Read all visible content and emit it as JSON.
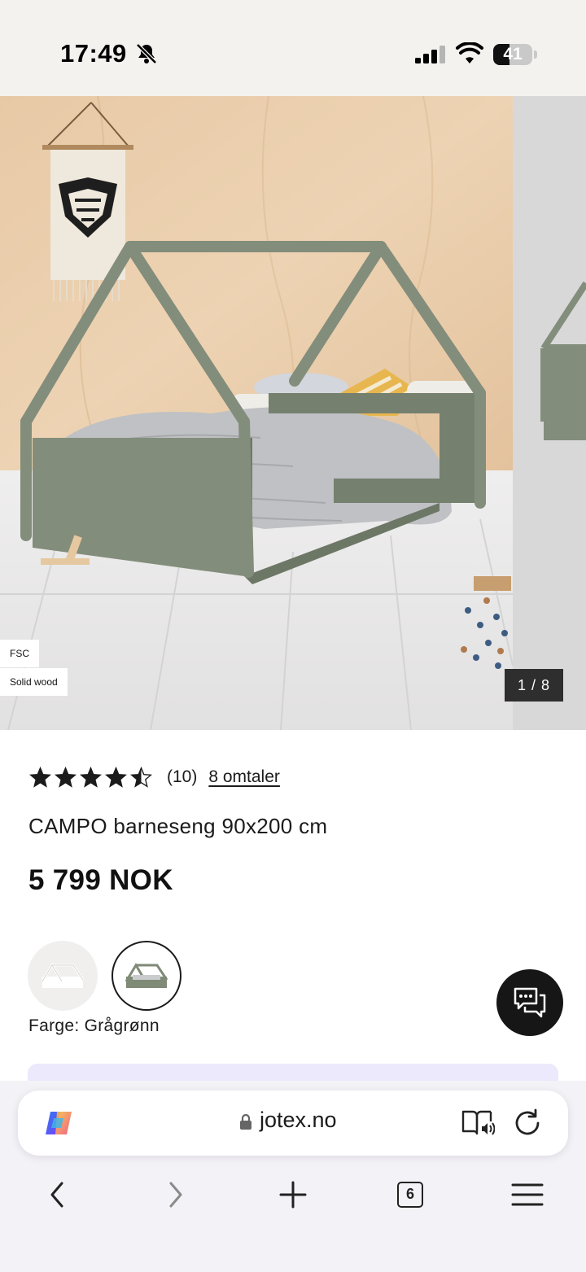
{
  "status_bar": {
    "time": "17:49",
    "battery": "41",
    "battery_level": 0.41,
    "icons": [
      "bell-slash-icon",
      "cellular-signal-icon",
      "wifi-icon",
      "battery-icon"
    ]
  },
  "gallery": {
    "badges": [
      "FSC",
      "Solid wood"
    ],
    "counter": "1 / 8"
  },
  "product": {
    "rating": 4.5,
    "rating_count": "(10)",
    "reviews_link": "8 omtaler",
    "title": "CAMPO barneseng 90x200 cm",
    "price": "5 799 NOK",
    "color_label": "Farge: Grågrønn",
    "swatches": [
      {
        "name": "white",
        "color": "#f0efee",
        "selected": false
      },
      {
        "name": "Grågrønn",
        "color": "#7f8a77",
        "selected": true
      }
    ]
  },
  "colors": {
    "bed_green": "#838d7b",
    "promo_strip": "#ebe9fb",
    "chat_button": "#161616"
  },
  "browser": {
    "url": "jotex.no",
    "tab_count": "6",
    "icons": [
      "copilot-icon",
      "lock-icon",
      "reader-mode-icon",
      "reload-icon",
      "back-icon",
      "forward-icon",
      "new-tab-icon",
      "tabs-icon",
      "menu-icon"
    ]
  }
}
